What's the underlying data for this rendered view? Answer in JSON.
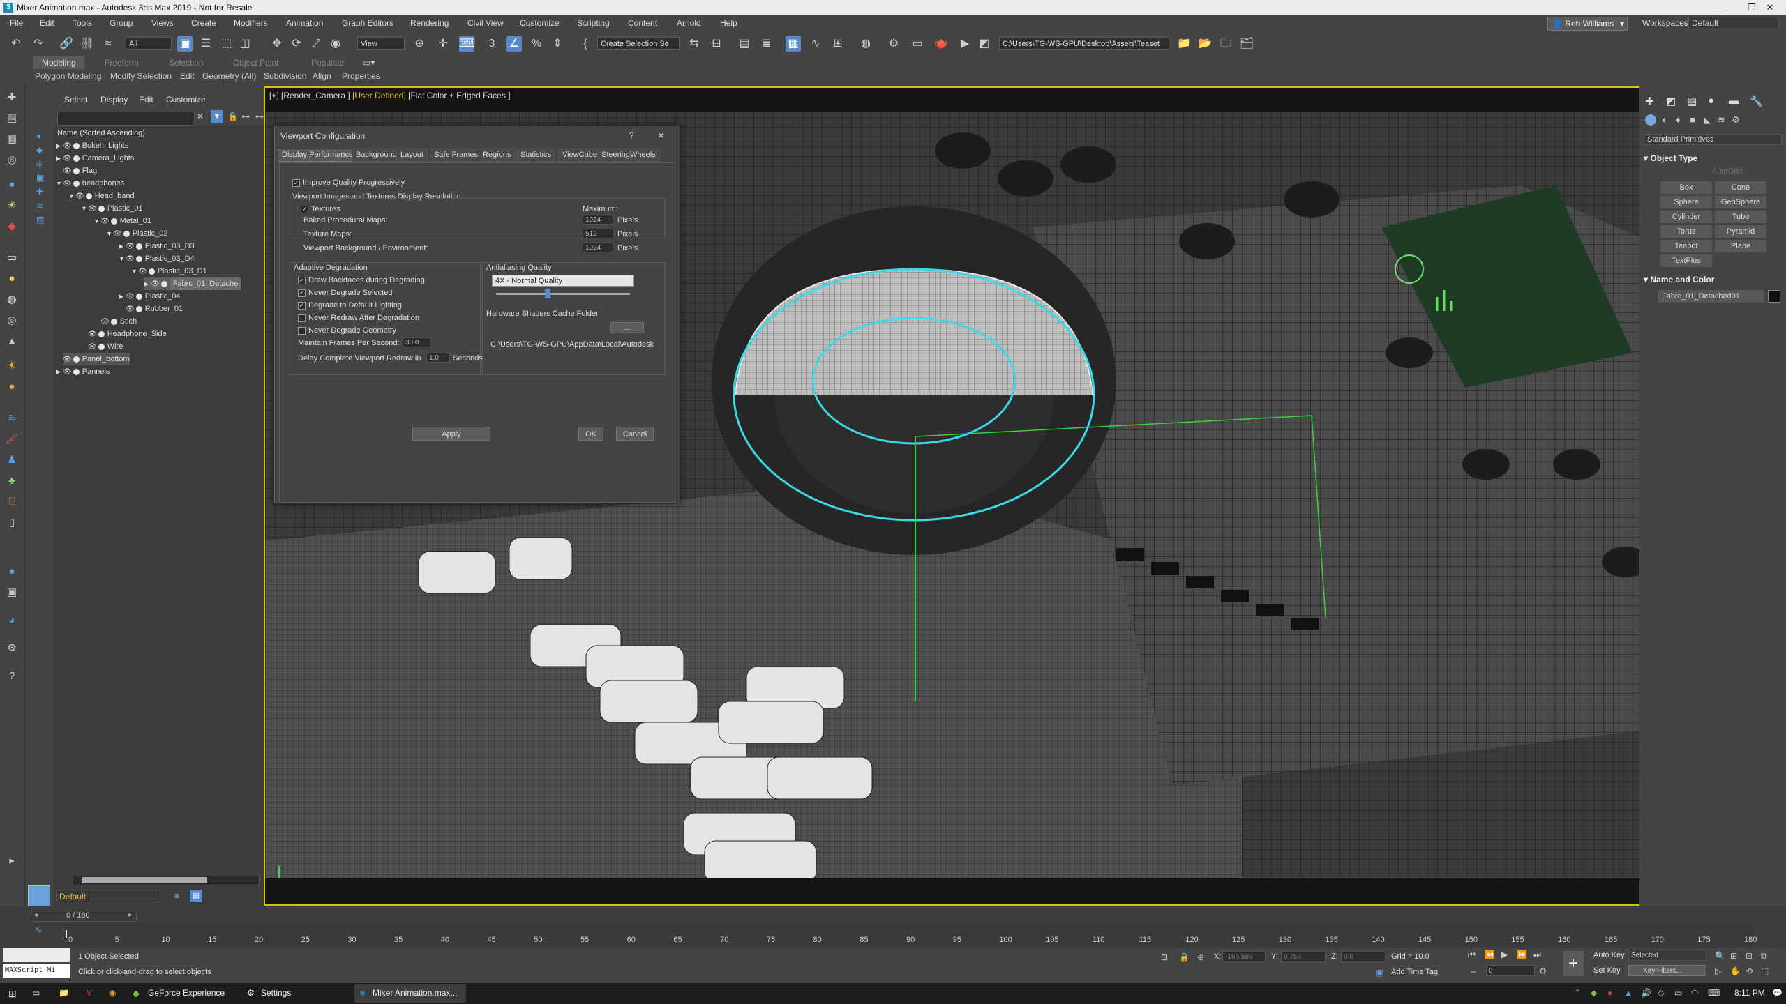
{
  "title": {
    "text": "Mixer Animation.max - Autodesk 3ds Max 2019 - Not for Resale",
    "app_icon": "3ds-max-icon"
  },
  "menu": [
    "File",
    "Edit",
    "Tools",
    "Group",
    "Views",
    "Create",
    "Modifiers",
    "Animation",
    "Graph Editors",
    "Rendering",
    "Civil View",
    "Customize",
    "Scripting",
    "Content",
    "Arnold",
    "Help"
  ],
  "user": {
    "name": "Rob Williams",
    "workspaces_label": "Workspaces:",
    "workspace": "Default"
  },
  "toolbar": {
    "selection_filter": "All",
    "ref_coord": "View",
    "named_selection": "Create Selection Se",
    "project_path": "C:\\Users\\TG-WS-GPU\\Desktop\\Assets\\Teaset"
  },
  "ribbon": {
    "tabs": [
      "Modeling",
      "Freeform",
      "Selection",
      "Object Paint",
      "Populate"
    ],
    "sub": [
      "Polygon Modeling",
      "Modify Selection",
      "Edit",
      "Geometry (All)",
      "Subdivision",
      "Align",
      "Properties"
    ]
  },
  "scene": {
    "tabs": [
      "Select",
      "Display",
      "Edit",
      "Customize"
    ],
    "header": "Name (Sorted Ascending)",
    "rows": [
      {
        "name": "Bokeh_Lights"
      },
      {
        "name": "Camera_Lights"
      },
      {
        "name": "Flag"
      },
      {
        "name": "headphones"
      },
      {
        "name": "Head_band"
      },
      {
        "name": "Plastic_01"
      },
      {
        "name": "Metal_01"
      },
      {
        "name": "Plastic_02"
      },
      {
        "name": "Plastic_03_D3"
      },
      {
        "name": "Plastic_03_D4"
      },
      {
        "name": "Plastic_03_D1"
      },
      {
        "name": "Fabrc_01_Detache"
      },
      {
        "name": "Plastic_04"
      },
      {
        "name": "Rubber_01"
      },
      {
        "name": "Stich"
      },
      {
        "name": "Headphone_Side"
      },
      {
        "name": "Wire"
      },
      {
        "name": "Panel_bottom"
      },
      {
        "name": "Pannels"
      }
    ],
    "layer": "Default"
  },
  "viewport": {
    "label_prefix": "[+] [Render_Camera ]",
    "label_shading": "[User Defined]",
    "label_suffix": "[Flat Color + Edged Faces ]"
  },
  "dialog": {
    "title": "Viewport Configuration",
    "help": "?",
    "close": "✕",
    "tabs": [
      "Display Performance",
      "Background",
      "Layout",
      "Safe Frames",
      "Regions",
      "Statistics",
      "ViewCube",
      "SteeringWheels"
    ],
    "improve_quality": "Improve Quality Progressively",
    "images_header": "Viewport Images and Textures Display Resolution",
    "textures": "Textures",
    "maximum": "Maximum:",
    "baked": "Baked Procedural Maps:",
    "baked_val": "1024",
    "texture_maps": "Texture Maps:",
    "texture_maps_val": "512",
    "vp_bg": "Viewport Background / Environment:",
    "vp_bg_val": "1024",
    "pixels": "Pixels",
    "adaptive": "Adaptive Degradation",
    "draw_backfaces": "Draw Backfaces during Degrading",
    "never_degrade_sel": "Never Degrade Selected",
    "degrade_lighting": "Degrade to Default Lighting",
    "never_redraw": "Never Redraw After Degradation",
    "never_degrade_geo": "Never Degrade Geometry",
    "maintain_fps": "Maintain Frames Per Second:",
    "maintain_fps_val": "30.0",
    "delay_redraw": "Delay Complete Viewport Redraw in",
    "delay_val": "1.0",
    "seconds": "Seconds",
    "aa_header": "Antialiasing Quality",
    "aa_value": "4X - Normal Quality",
    "cache_header": "Hardware Shaders Cache Folder",
    "cache_browse": "...",
    "cache_path": "C:\\Users\\TG-WS-GPU\\AppData\\Local\\Autodesk",
    "apply": "Apply",
    "ok": "OK",
    "cancel": "Cancel"
  },
  "command_panel": {
    "category": "Standard Primitives",
    "object_type": "Object Type",
    "autogrid": "AutoGrid",
    "primitives": [
      "Box",
      "Cone",
      "Sphere",
      "GeoSphere",
      "Cylinder",
      "Tube",
      "Torus",
      "Pyramid",
      "Teapot",
      "Plane",
      "TextPlus"
    ],
    "name_color": "Name and Color",
    "object_name": "Fabrc_01_Detached01",
    "object_color": "#111111"
  },
  "timeline": {
    "frame_readout": "0 / 180",
    "ticks": [
      "0",
      "5",
      "10",
      "15",
      "20",
      "25",
      "30",
      "35",
      "40",
      "45",
      "50",
      "55",
      "60",
      "65",
      "70",
      "75",
      "80",
      "85",
      "90",
      "95",
      "100",
      "105",
      "110",
      "115",
      "120",
      "125",
      "130",
      "135",
      "140",
      "145",
      "150",
      "155",
      "160",
      "165",
      "170",
      "175",
      "180"
    ]
  },
  "status": {
    "maxscript": "MAXScript Mi",
    "selected": "1 Object Selected",
    "hint": "Click or click-and-drag to select objects",
    "x_label": "X:",
    "x_val": "-166.589",
    "y_label": "Y:",
    "y_val": "9.753",
    "z_label": "Z:",
    "z_val": "0.0",
    "grid": "Grid = 10.0",
    "add_time_tag": "Add Time Tag",
    "auto_key": "Auto Key",
    "set_key": "Set Key",
    "key_mode": "Selected",
    "key_filters": "Key Filters...",
    "frame": "0"
  },
  "taskbar": {
    "apps": [
      "GeForce Experience",
      "Settings",
      "Mixer Animation.max..."
    ],
    "time": "8:11 PM"
  }
}
